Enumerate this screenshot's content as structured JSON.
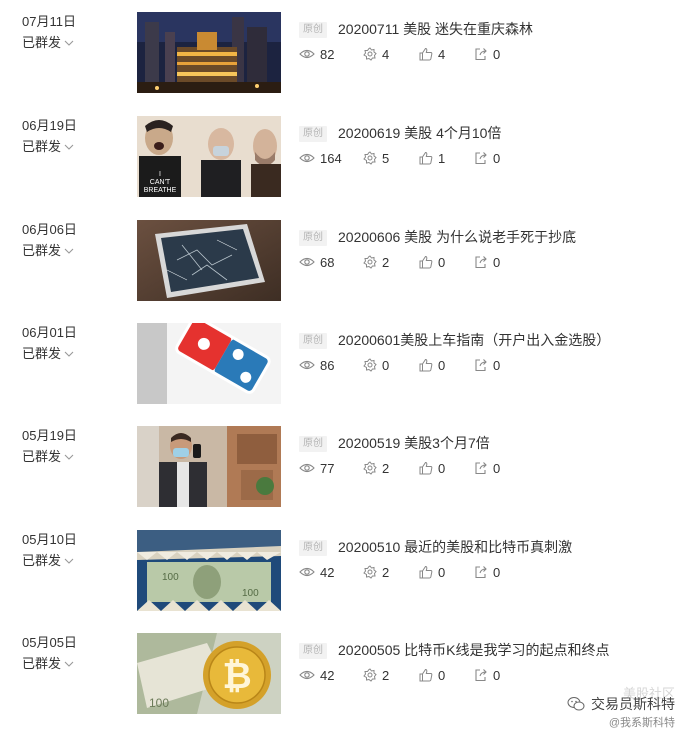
{
  "status_label": "已群发",
  "original_badge": "原创",
  "articles": [
    {
      "date": "07月11日",
      "title": "20200711 美股 迷失在重庆森林",
      "reads": "82",
      "looks": "4",
      "likes": "4",
      "shares": "0",
      "thumb_icon": "city-night-icon"
    },
    {
      "date": "06月19日",
      "title": "20200619 美股 4个月10倍",
      "reads": "164",
      "looks": "5",
      "likes": "1",
      "shares": "0",
      "thumb_icon": "protest-masks-icon"
    },
    {
      "date": "06月06日",
      "title": "20200606 美股 为什么说老手死于抄底",
      "reads": "68",
      "looks": "2",
      "likes": "0",
      "shares": "0",
      "thumb_icon": "broken-screen-icon"
    },
    {
      "date": "06月01日",
      "title": "20200601美股上车指南（开户出入金选股）",
      "reads": "86",
      "looks": "0",
      "likes": "0",
      "shares": "0",
      "thumb_icon": "dominos-logo-icon"
    },
    {
      "date": "05月19日",
      "title": "20200519 美股3个月7倍",
      "reads": "77",
      "looks": "2",
      "likes": "0",
      "shares": "0",
      "thumb_icon": "masked-man-phone-icon"
    },
    {
      "date": "05月10日",
      "title": "20200510 最近的美股和比特币真刺激",
      "reads": "42",
      "looks": "2",
      "likes": "0",
      "shares": "0",
      "thumb_icon": "dollar-bill-jaws-icon"
    },
    {
      "date": "05月05日",
      "title": "20200505 比特币K线是我学习的起点和终点",
      "reads": "42",
      "looks": "2",
      "likes": "0",
      "shares": "0",
      "thumb_icon": "bitcoin-coin-icon"
    }
  ],
  "watermark": {
    "faint": "美股社区",
    "main": "交易员斯科特",
    "sub": "@我系斯科特"
  }
}
